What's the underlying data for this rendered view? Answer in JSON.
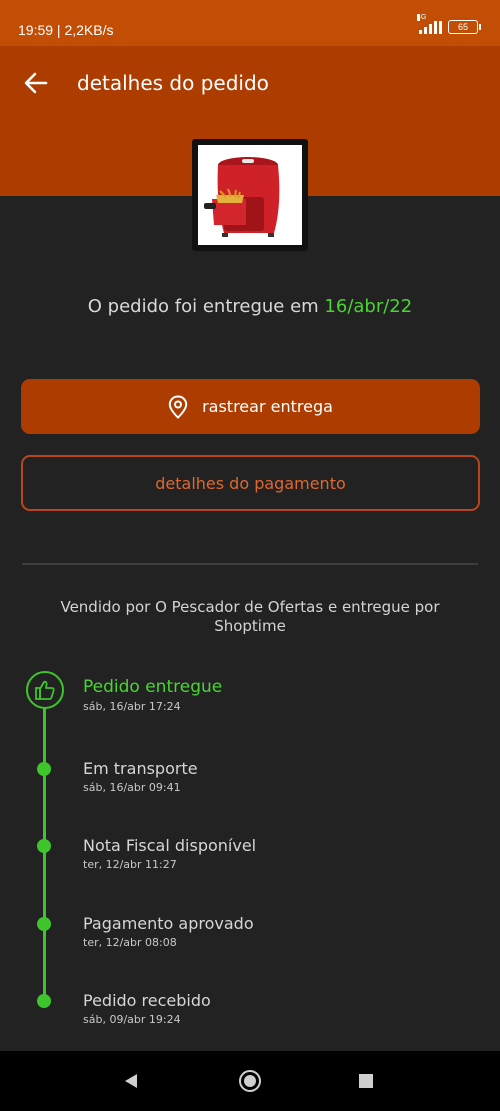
{
  "status_bar": {
    "time_speed": "19:59 | 2,2KB/s",
    "network": "4G",
    "battery": "65"
  },
  "header": {
    "title": "detalhes do pedido"
  },
  "order": {
    "delivered_prefix": "O pedido foi entregue em ",
    "delivered_date": "16/abr/22"
  },
  "actions": {
    "track_label": "rastrear entrega",
    "payment_label": "detalhes do pagamento"
  },
  "seller_info": "Vendido por O Pescador de Ofertas e entregue por Shoptime",
  "timeline": [
    {
      "title": "Pedido entregue",
      "date": "sáb, 16/abr 17:24"
    },
    {
      "title": "Em transporte",
      "date": "sáb, 16/abr 09:41"
    },
    {
      "title": "Nota Fiscal disponível",
      "date": "ter, 12/abr 11:27"
    },
    {
      "title": "Pagamento aprovado",
      "date": "ter, 12/abr 08:08"
    },
    {
      "title": "Pedido recebido",
      "date": "sáb, 09/abr 19:24"
    }
  ],
  "colors": {
    "status_bar": "#c24d05",
    "header": "#ad3c00",
    "accent_green": "#4ad534",
    "background": "#222222"
  },
  "icons": [
    "back-arrow-icon",
    "location-pin-icon",
    "thumbs-up-icon",
    "nav-back-icon",
    "nav-home-icon",
    "nav-recents-icon"
  ]
}
